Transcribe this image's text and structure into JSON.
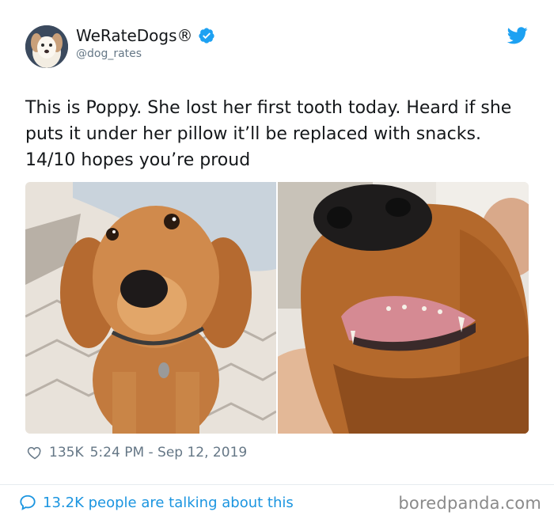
{
  "account": {
    "display_name": "WeRateDogs®",
    "handle": "@dog_rates",
    "verified_icon": "verified-badge-icon",
    "platform_icon": "twitter-bird-icon"
  },
  "tweet": {
    "text": "This is Poppy. She lost her first tooth today. Heard if she puts it under her pillow it’ll be replaced with snacks. 14/10 hopes you’re proud",
    "likes": "135K",
    "timestamp": "5:24 PM - Sep 12, 2019"
  },
  "footer": {
    "conversation_text": "13.2K people are talking about this",
    "watermark": "boredpanda.com"
  },
  "colors": {
    "link_blue": "#1b95e0",
    "twitter_blue": "#1da1f2",
    "muted_gray": "#657786"
  }
}
